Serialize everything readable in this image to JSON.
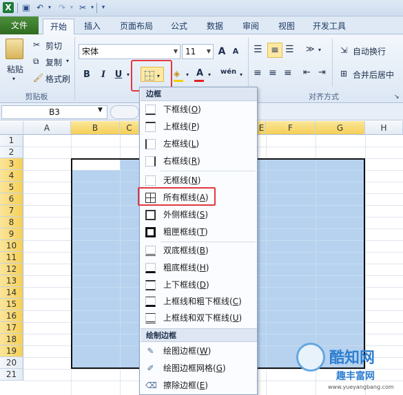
{
  "tabs": [
    "文件",
    "开始",
    "插入",
    "页面布局",
    "公式",
    "数据",
    "审阅",
    "视图",
    "开发工具"
  ],
  "clipboard": {
    "paste": "粘贴",
    "cut": "剪切",
    "copy": "复制",
    "format_painter": "格式刷",
    "group_label": "剪贴板"
  },
  "font": {
    "name": "宋体",
    "size": "11",
    "grow": "A",
    "shrink": "A",
    "bold": "B",
    "italic": "I",
    "underline": "U",
    "font_color": "A",
    "wen": "wén"
  },
  "alignment": {
    "wrap": "自动换行",
    "merge": "合并后居中",
    "group_label": "对齐方式"
  },
  "formula_bar": {
    "name_box": "B3"
  },
  "columns": [
    "A",
    "B",
    "C",
    "D",
    "E",
    "F",
    "G",
    "H"
  ],
  "rows": [
    "1",
    "2",
    "3",
    "4",
    "5",
    "6",
    "7",
    "8",
    "9",
    "10",
    "11",
    "12",
    "13",
    "14",
    "15",
    "16",
    "17",
    "18",
    "19",
    "20",
    "21"
  ],
  "menu": {
    "header_borders": "边框",
    "header_draw": "绘制边框",
    "items": [
      {
        "label": "下框线",
        "key": "O"
      },
      {
        "label": "上框线",
        "key": "P"
      },
      {
        "label": "左框线",
        "key": "L"
      },
      {
        "label": "右框线",
        "key": "R"
      },
      {
        "label": "无框线",
        "key": "N"
      },
      {
        "label": "所有框线",
        "key": "A"
      },
      {
        "label": "外侧框线",
        "key": "S"
      },
      {
        "label": "粗匣框线",
        "key": "T"
      },
      {
        "label": "双底框线",
        "key": "B"
      },
      {
        "label": "粗底框线",
        "key": "H"
      },
      {
        "label": "上下框线",
        "key": "D"
      },
      {
        "label": "上框线和粗下框线",
        "key": "C"
      },
      {
        "label": "上框线和双下框线",
        "key": "U"
      }
    ],
    "draw_items": [
      {
        "label": "绘图边框",
        "key": "W"
      },
      {
        "label": "绘图边框网格",
        "key": "G"
      },
      {
        "label": "擦除边框",
        "key": "E"
      }
    ]
  },
  "watermark": {
    "brand": "酷知网",
    "site": "趣丰富网",
    "url": "www.yueyangbang.com"
  }
}
